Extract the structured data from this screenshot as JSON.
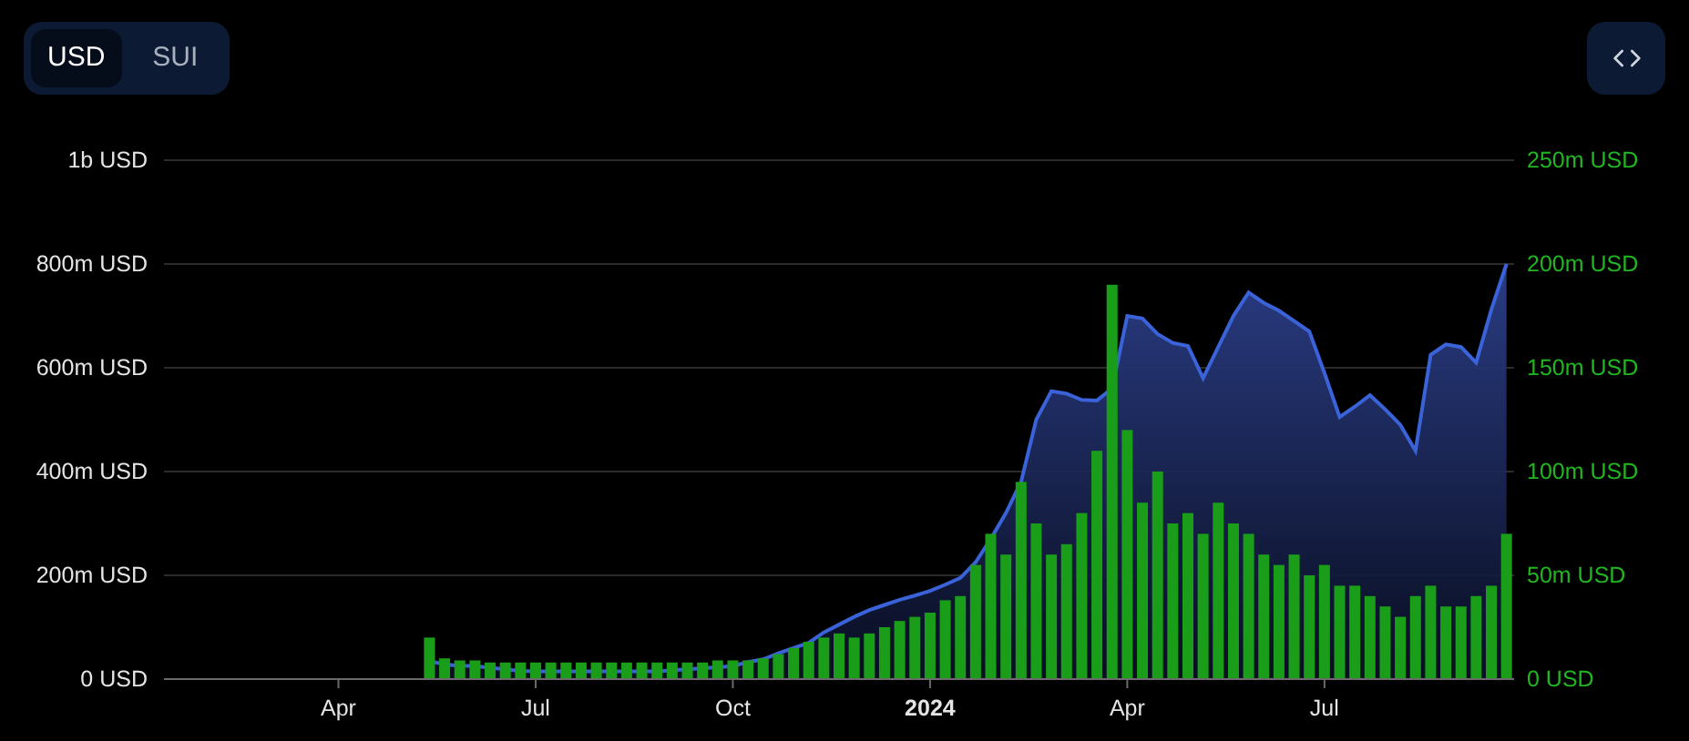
{
  "currency_toggle": [
    {
      "label": "USD",
      "selected": true
    },
    {
      "label": "SUI",
      "selected": false
    }
  ],
  "chart": {
    "chart_data": {
      "type": "area",
      "grid": true,
      "ylim": [
        0,
        1000000000.0
      ],
      "y2lim": [
        0,
        250000000.0
      ],
      "categories": [
        null,
        null,
        null,
        null,
        null,
        null,
        null,
        null,
        null,
        null,
        null,
        "Apr",
        null,
        null,
        null,
        null,
        null,
        null,
        null,
        null,
        null,
        null,
        null,
        null,
        "Jul",
        null,
        null,
        null,
        null,
        null,
        null,
        null,
        null,
        null,
        null,
        null,
        null,
        "Oct",
        null,
        null,
        null,
        null,
        null,
        null,
        null,
        null,
        null,
        null,
        null,
        null,
        "2024",
        null,
        null,
        null,
        null,
        null,
        null,
        null,
        null,
        null,
        null,
        null,
        null,
        "Apr",
        null,
        null,
        null,
        null,
        null,
        null,
        null,
        null,
        null,
        null,
        null,
        null,
        "Jul",
        null,
        null,
        null,
        null,
        null,
        null,
        null,
        null,
        null,
        null,
        null,
        null
      ],
      "yticks": [
        {
          "value": 0,
          "label": "0 USD"
        },
        {
          "value": 200000000.0,
          "label": "200m USD"
        },
        {
          "value": 400000000.0,
          "label": "400m USD"
        },
        {
          "value": 600000000.0,
          "label": "600m USD"
        },
        {
          "value": 800000000.0,
          "label": "800m USD"
        },
        {
          "value": 1000000000.0,
          "label": "1b USD"
        }
      ],
      "y2ticks": [
        {
          "value": 0,
          "label": "0 USD"
        },
        {
          "value": 50000000.0,
          "label": "50m USD"
        },
        {
          "value": 100000000.0,
          "label": "100m USD"
        },
        {
          "value": 150000000.0,
          "label": "150m USD"
        },
        {
          "value": 200000000.0,
          "label": "200m USD"
        },
        {
          "value": 250000000.0,
          "label": "250m USD"
        }
      ],
      "series": [
        {
          "color": "#3b63d9",
          "values": [
            null,
            null,
            null,
            null,
            null,
            null,
            null,
            null,
            null,
            null,
            null,
            null,
            null,
            null,
            null,
            null,
            null,
            35000000.0,
            28000000.0,
            26000000.0,
            25000000.0,
            22000000.0,
            19000000.0,
            16000000.0,
            15000000.0,
            15000000.0,
            15000000.0,
            15000000.0,
            15000000.0,
            15000000.0,
            15000000.0,
            15000000.0,
            15000000.0,
            17000000.0,
            19000000.0,
            21000000.0,
            23000000.0,
            25000000.0,
            33000000.0,
            38000000.0,
            50000000.0,
            60000000.0,
            70000000.0,
            90000000.0,
            105000000.0,
            120000000.0,
            133000000.0,
            143000000.0,
            153000000.0,
            161000000.0,
            170000000.0,
            182000000.0,
            195000000.0,
            225000000.0,
            270000000.0,
            320000000.0,
            380000000.0,
            500000000.0,
            555000000.0,
            550000000.0,
            538000000.0,
            537000000.0,
            560000000.0,
            700000000.0,
            695000000.0,
            665000000.0,
            648000000.0,
            642000000.0,
            580000000.0,
            640000000.0,
            700000000.0,
            745000000.0,
            725000000.0,
            710000000.0,
            690000000.0,
            670000000.0,
            590000000.0,
            505000000.0,
            525000000.0,
            547000000.0,
            520000000.0,
            490000000.0,
            440000000.0,
            625000000.0,
            645000000.0,
            640000000.0,
            610000000.0,
            712000000.0,
            800000000.0
          ]
        },
        {
          "type": "bar",
          "axis": "y2",
          "color": "#1a9e1a",
          "values": [
            null,
            null,
            null,
            null,
            null,
            null,
            null,
            null,
            null,
            null,
            null,
            null,
            null,
            null,
            null,
            null,
            null,
            20000000.0,
            10000000.0,
            9000000.0,
            9000000.0,
            8000000.0,
            8000000.0,
            8000000.0,
            8000000.0,
            8000000.0,
            8000000.0,
            8000000.0,
            8000000.0,
            8000000.0,
            8000000.0,
            8000000.0,
            8000000.0,
            8000000.0,
            8000000.0,
            8000000.0,
            9000000.0,
            9000000.0,
            9000000.0,
            10000000.0,
            12000000.0,
            15000000.0,
            18000000.0,
            20000000.0,
            22000000.0,
            20000000.0,
            22000000.0,
            25000000.0,
            28000000.0,
            30000000.0,
            32000000.0,
            38000000.0,
            40000000.0,
            55000000.0,
            70000000.0,
            60000000.0,
            95000000.0,
            75000000.0,
            60000000.0,
            65000000.0,
            80000000.0,
            110000000.0,
            190000000.0,
            120000000.0,
            85000000.0,
            100000000.0,
            75000000.0,
            80000000.0,
            70000000.0,
            85000000.0,
            75000000.0,
            70000000.0,
            60000000.0,
            55000000.0,
            60000000.0,
            50000000.0,
            55000000.0,
            45000000.0,
            45000000.0,
            40000000.0,
            35000000.0,
            30000000.0,
            40000000.0,
            45000000.0,
            35000000.0,
            35000000.0,
            40000000.0,
            45000000.0,
            70000000.0
          ]
        }
      ]
    }
  }
}
